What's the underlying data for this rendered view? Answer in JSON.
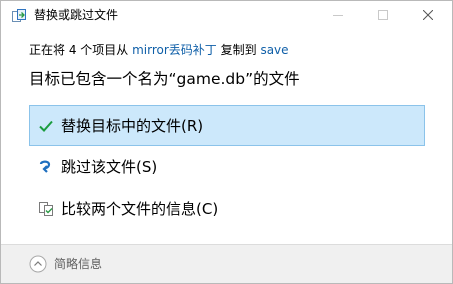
{
  "window": {
    "title": "替换或跳过文件"
  },
  "progress": {
    "prefix": "正在将 4 个项目从 ",
    "source": "mirror丢码补丁",
    "middle": " 复制到 ",
    "destination": "save"
  },
  "heading": "目标已包含一个名为“game.db”的文件",
  "options": [
    {
      "label": "替换目标中的文件(R)",
      "icon": "checkmark-icon",
      "selected": true
    },
    {
      "label": "跳过该文件(S)",
      "icon": "skip-arrow-icon",
      "selected": false
    },
    {
      "label": "比较两个文件的信息(C)",
      "icon": "compare-files-icon",
      "selected": false
    }
  ],
  "footer": {
    "details_label": "简略信息"
  },
  "colors": {
    "selected_bg": "#cce8fb",
    "selected_border": "#8bc3ea",
    "link": "#0f5fa8",
    "check": "#1a9c3f",
    "skip_arrow": "#1f6fbf",
    "footer_bg": "#f0f0f0"
  }
}
